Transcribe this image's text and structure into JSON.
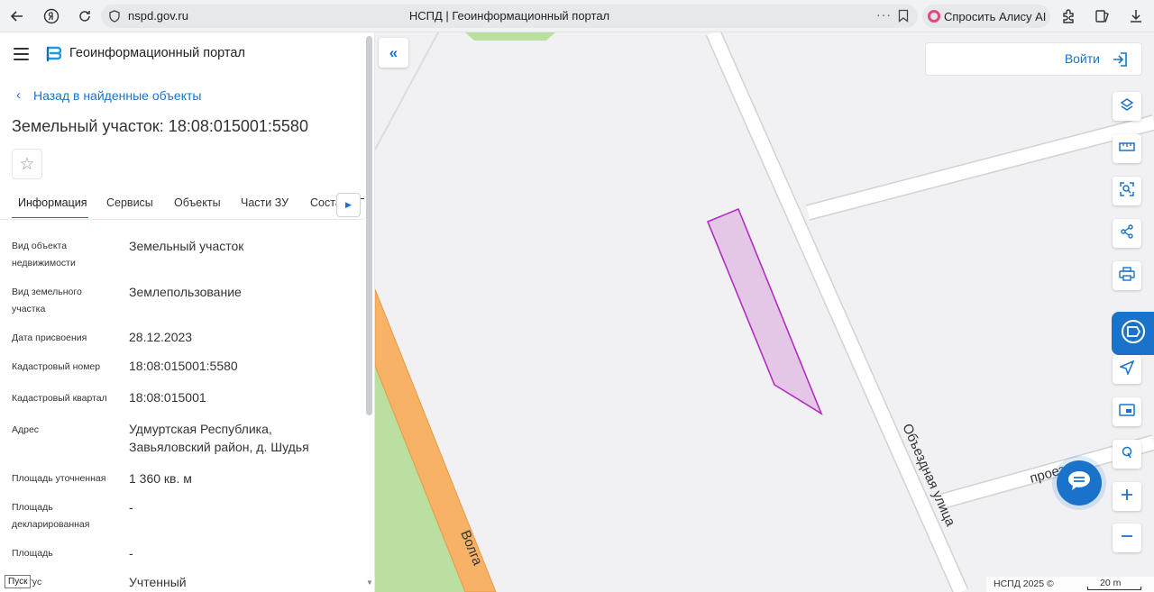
{
  "browser": {
    "url": "nspd.gov.ru",
    "tab_title": "НСПД | Геоинформационный портал",
    "alice_label": "Спросить Алису AI",
    "url_dots": "···"
  },
  "header": {
    "portal_title": "Геоинформационный портал"
  },
  "panel": {
    "back_label": "Назад в найденные объекты",
    "object_title": "Земельный участок: 18:08:015001:5580",
    "tabs": [
      {
        "label": "Информация"
      },
      {
        "label": "Сервисы"
      },
      {
        "label": "Объекты"
      },
      {
        "label": "Части ЗУ"
      },
      {
        "label": "Состав ПП"
      }
    ],
    "properties": [
      {
        "label": "Вид объекта недвижимости",
        "value": "Земельный участок"
      },
      {
        "label": "Вид земельного участка",
        "value": "Землепользование"
      },
      {
        "label": "Дата присвоения",
        "value": "28.12.2023"
      },
      {
        "label": "Кадастровый номер",
        "value": "18:08:015001:5580"
      },
      {
        "label": "Кадастровый квартал",
        "value": "18:08:015001"
      },
      {
        "label": "Адрес",
        "value": "Удмуртская Республика, Завьяловский район, д. Шудья"
      },
      {
        "label": "Площадь уточненная",
        "value": "1 360 кв. м"
      },
      {
        "label": "Площадь декларированная",
        "value": "-"
      },
      {
        "label": "Площадь",
        "value": "-"
      },
      {
        "label": "Статус",
        "value": "Учтенный"
      }
    ],
    "tooltip": "Пуск"
  },
  "map": {
    "login_label": "Войти",
    "street_1": "Объездная улица",
    "street_2": "Волга",
    "street_3": "проезд",
    "copyright": "НСПД 2025 ©",
    "scale": "20 m",
    "parcel_color": "#e4c6e6",
    "parcel_stroke": "#b02fc0",
    "accent": "#1a73c9"
  }
}
